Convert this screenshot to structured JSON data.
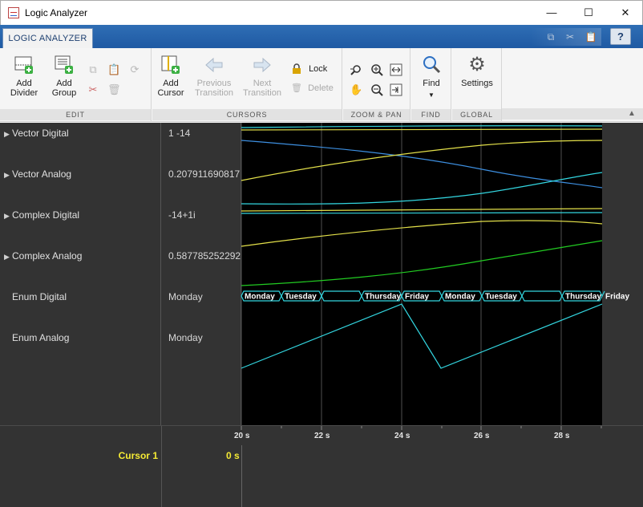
{
  "window": {
    "title": "Logic Analyzer"
  },
  "ribbon": {
    "tab": "LOGIC ANALYZER",
    "sections": {
      "edit": {
        "label": "EDIT",
        "add_divider": "Add Divider",
        "add_group": "Add Group"
      },
      "cursors": {
        "label": "CURSORS",
        "add_cursor": "Add Cursor",
        "previous_transition": "Previous Transition",
        "next_transition": "Next Transition",
        "lock": "Lock",
        "delete": "Delete"
      },
      "zoom_pan": {
        "label": "ZOOM & PAN"
      },
      "find": {
        "label": "FIND",
        "find": "Find"
      },
      "global": {
        "label": "GLOBAL",
        "settings": "Settings"
      }
    }
  },
  "signals": [
    {
      "name": "Vector Digital",
      "value": "1 -14",
      "expandable": true
    },
    {
      "name": "Vector Analog",
      "value": "0.207911690817",
      "expandable": true
    },
    {
      "name": "Complex Digital",
      "value": "-14+1i",
      "expandable": true
    },
    {
      "name": "Complex Analog",
      "value": "0.587785252292",
      "expandable": true
    },
    {
      "name": "Enum Digital",
      "value": "Monday",
      "expandable": false
    },
    {
      "name": "Enum Analog",
      "value": "Monday",
      "expandable": false
    }
  ],
  "enum_digital_labels": [
    "Monday",
    "Tuesday",
    "",
    "Thursday",
    "Friday",
    "Monday",
    "Tuesday",
    "",
    "Thursday",
    "Friday"
  ],
  "time_axis": {
    "ticks": [
      "20 s",
      "22 s",
      "24 s",
      "26 s",
      "28 s"
    ]
  },
  "cursor": {
    "name": "Cursor 1",
    "value": "0 s"
  },
  "colors": {
    "plot_bg": "#000000",
    "cyan": "#33d6e0",
    "yellow": "#e3e04a",
    "blue": "#3d8fe0",
    "green": "#22cc22",
    "cursor_text": "#f5ea34"
  }
}
